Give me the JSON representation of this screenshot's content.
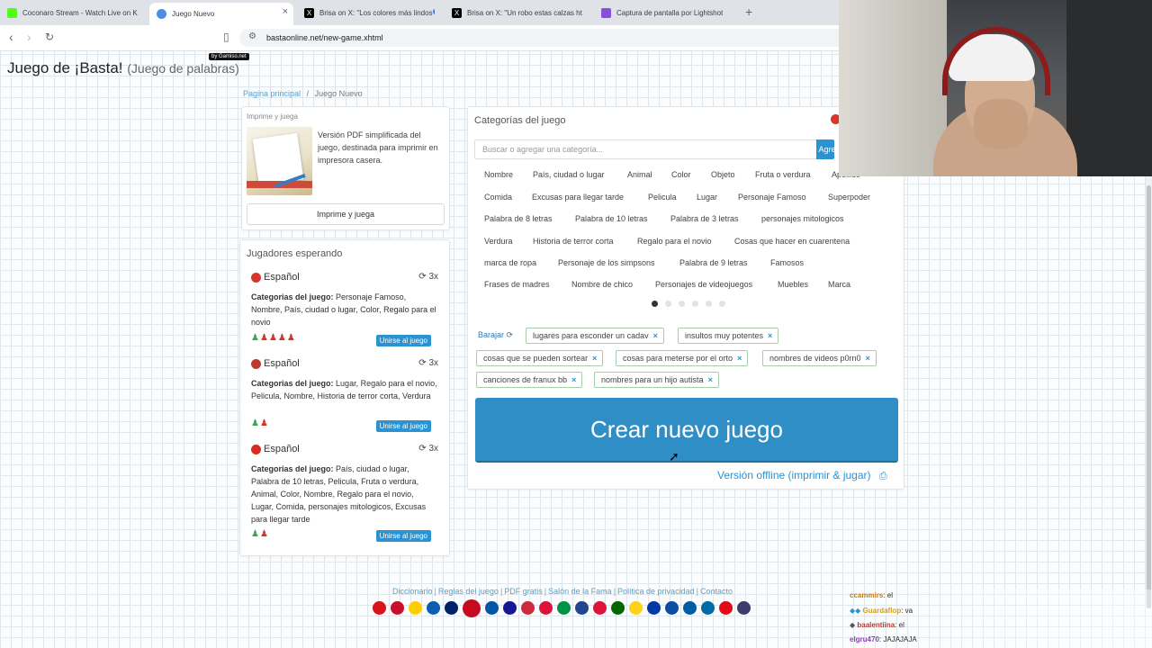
{
  "browser": {
    "tabs": [
      {
        "label": "Coconaro Stream - Watch Live on Ki",
        "icon": "kick-icon",
        "color": "#53fc18",
        "active": false
      },
      {
        "label": "Juego Nuevo",
        "icon": "basta-icon",
        "color": "#4a90e2",
        "active": true
      },
      {
        "label": "Brisa on X: \"Los colores más lindos💙",
        "icon": "x-icon",
        "color": "#000000",
        "active": false
      },
      {
        "label": "Brisa on X: \"Un robo estas calzas http",
        "icon": "x-icon",
        "color": "#000000",
        "active": false
      },
      {
        "label": "Captura de pantalla por Lightshot",
        "icon": "lightshot-icon",
        "color": "#8a4fd8",
        "active": false
      }
    ],
    "url": "bastaonline.net/new-game.xhtml"
  },
  "header": {
    "title": "Juego de ¡Basta!",
    "subtitle": "(Juego de palabras)",
    "badge": "by Gamiso.net"
  },
  "breadcrumb": {
    "home": "Pagina principal",
    "separator": "/",
    "current": "Juego Nuevo"
  },
  "print_box": {
    "title": "Imprime y juega",
    "description": "Versión PDF simplificada del juego, destinada para imprimir en impresora casera.",
    "button": "Imprime y juega"
  },
  "players": {
    "title": "Jugadores esperando",
    "categories_label": "Categorias del juego:",
    "join_label": "Unirse al juego",
    "games": [
      {
        "language": "Español",
        "rounds": "3x",
        "flag_color": "#d9342b",
        "categories": "Personaje Famoso, Nombre, País, ciudad o lugar, Color, Regalo para el novio",
        "users": [
          "#3aa757",
          "#d9342b",
          "#d9342b",
          "#d9342b",
          "#d9342b"
        ]
      },
      {
        "language": "Español",
        "rounds": "3x",
        "flag_color": "#c0392b",
        "categories": "Lugar, Regalo para el novio, Pelicula, Nombre, Historia de terror corta, Verdura",
        "users": [
          "#3aa757",
          "#d9342b"
        ]
      },
      {
        "language": "Español",
        "rounds": "3x",
        "flag_color": "#d62d20",
        "categories": "País, ciudad o lugar, Palabra de 10 letras, Pelicula, Fruta o verdura, Animal, Color, Nombre, Regalo para el novio, Lugar, Comida, personajes mitologicos, Excusas para llegar tarde",
        "users": [
          "#3aa757",
          "#d9342b"
        ]
      }
    ]
  },
  "categories": {
    "title": "Categorías del juego",
    "search_placeholder": "Buscar o agregar una categoría...",
    "add_button": "Agregar",
    "rows": [
      [
        "Nombre",
        "País, ciudad o lugar",
        "Animal",
        "Color",
        "Objeto",
        "Fruta o verdura",
        "Apellido"
      ],
      [
        "Comida",
        "Excusas para llegar tarde",
        "Pelicula",
        "Lugar",
        "Personaje Famoso",
        "Superpoder"
      ],
      [
        "Palabra de 8 letras",
        "Palabra de 10 letras",
        "Palabra de 3 letras",
        "personajes mitologicos"
      ],
      [
        "Verdura",
        "Historia de terror corta",
        "Regalo para el novio",
        "Cosas que hacer en cuarentena"
      ],
      [
        "marca de ropa",
        "Personaje de los simpsons",
        "Palabra de 9 letras",
        "Famosos"
      ],
      [
        "Frases de madres",
        "Nombre de chico",
        "Personajes de videojuegos",
        "Muebles",
        "Marca"
      ]
    ],
    "page_count": 6,
    "current_page": 1,
    "shuffle_label": "Barajar",
    "selected": [
      "lugares para esconder un cadav",
      "insultos muy potentes",
      "cosas que se pueden sortear",
      "cosas para meterse por el orto",
      "nombres de videos p0rn0",
      "canciones de franux bb",
      "nombres para un hijo autista"
    ],
    "remove_symbol": "×",
    "create_button": "Crear nuevo juego",
    "offline_link": "Versión offline (imprimir & jugar)"
  },
  "footer": {
    "links": [
      "Diccionario",
      "Reglas del juego",
      "PDF gratis",
      "Salón de la Fama",
      "Política de privacidad",
      "Contacto"
    ],
    "flag_colors": [
      "#d7141a",
      "#c8102e",
      "#ffce00",
      "#0d5eaf",
      "#012169",
      "#c60b1e",
      "#0055a4",
      "#171796",
      "#cd2a3e",
      "#009246",
      "#21468b",
      "#dc143c",
      "#006600",
      "#fcd116",
      "#0039a6",
      "#0b4ea2",
      "#005da4",
      "#006aa7",
      "#e30a17",
      "#3c3b6e"
    ]
  },
  "chat": [
    {
      "user": "ccammirs",
      "text": ": el",
      "color": "#c27b16"
    },
    {
      "user": "Guardaflop",
      "text": ": va",
      "color": "#d4a017"
    },
    {
      "user": "baalentiina",
      "text": ": el",
      "color": "#c0392b"
    },
    {
      "user": "elgru470",
      "text": ": JAJAJAJA",
      "color": "#8e44ad"
    }
  ]
}
